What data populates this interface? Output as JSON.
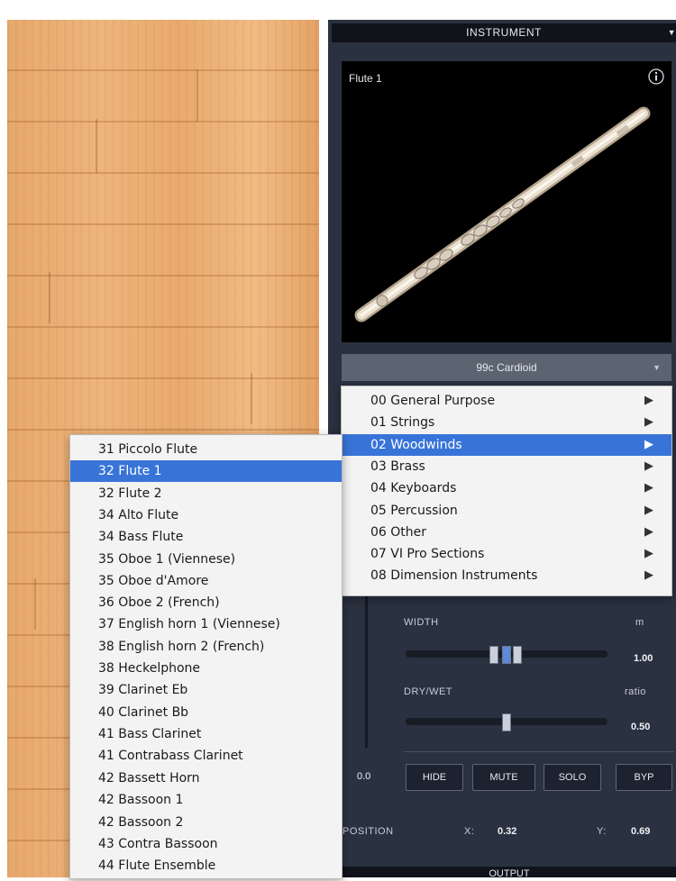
{
  "instrument_panel": {
    "header": "INSTRUMENT",
    "preview_title": "Flute 1",
    "mic_select": "99c Cardioid",
    "icons": {
      "info": "info-icon",
      "header_arrow": "chevron-down-icon",
      "mic_arrow": "chevron-down-icon"
    },
    "width": {
      "label": "WIDTH",
      "unit": "m",
      "value": "1.00"
    },
    "drywet": {
      "label": "DRY/WET",
      "unit": "ratio",
      "value": "0.50"
    },
    "fader_value": "0.0",
    "buttons": {
      "hide": "HIDE",
      "mute": "MUTE",
      "solo": "SOLO",
      "byp": "BYP"
    },
    "position": {
      "label": "POSITION",
      "x_label": "X:",
      "x_value": "0.32",
      "y_label": "Y:",
      "y_value": "0.69"
    },
    "output_label": "OUTPUT"
  },
  "category_menu": {
    "items": [
      {
        "label": "00 General Purpose",
        "selected": false
      },
      {
        "label": "01 Strings",
        "selected": false
      },
      {
        "label": "02 Woodwinds",
        "selected": true
      },
      {
        "label": "03 Brass",
        "selected": false
      },
      {
        "label": "04 Keyboards",
        "selected": false
      },
      {
        "label": "05 Percussion",
        "selected": false
      },
      {
        "label": "06 Other",
        "selected": false
      },
      {
        "label": "07 VI Pro Sections",
        "selected": false
      },
      {
        "label": "08 Dimension Instruments",
        "selected": false
      }
    ],
    "submenu_icon": "triangle-right-icon"
  },
  "instrument_menu": {
    "items": [
      {
        "label": "31 Piccolo Flute",
        "selected": false
      },
      {
        "label": "32 Flute 1",
        "selected": true
      },
      {
        "label": "32 Flute 2",
        "selected": false
      },
      {
        "label": "34 Alto Flute",
        "selected": false
      },
      {
        "label": "34 Bass Flute",
        "selected": false
      },
      {
        "label": "35 Oboe 1 (Viennese)",
        "selected": false
      },
      {
        "label": "35 Oboe d'Amore",
        "selected": false
      },
      {
        "label": "36 Oboe 2 (French)",
        "selected": false
      },
      {
        "label": "37 English horn 1 (Viennese)",
        "selected": false
      },
      {
        "label": "38 English horn 2 (French)",
        "selected": false
      },
      {
        "label": "38 Heckelphone",
        "selected": false
      },
      {
        "label": "39 Clarinet Eb",
        "selected": false
      },
      {
        "label": "40 Clarinet Bb",
        "selected": false
      },
      {
        "label": "41 Bass Clarinet",
        "selected": false
      },
      {
        "label": "41 Contrabass Clarinet",
        "selected": false
      },
      {
        "label": "42 Bassett Horn",
        "selected": false
      },
      {
        "label": "42 Bassoon 1",
        "selected": false
      },
      {
        "label": "42 Bassoon 2",
        "selected": false
      },
      {
        "label": "43 Contra Bassoon",
        "selected": false
      },
      {
        "label": "44 Flute Ensemble",
        "selected": false
      }
    ]
  },
  "colors": {
    "menu_highlight": "#3874d8",
    "panel_bg": "#2a3140",
    "wood": "#eeb47a"
  }
}
